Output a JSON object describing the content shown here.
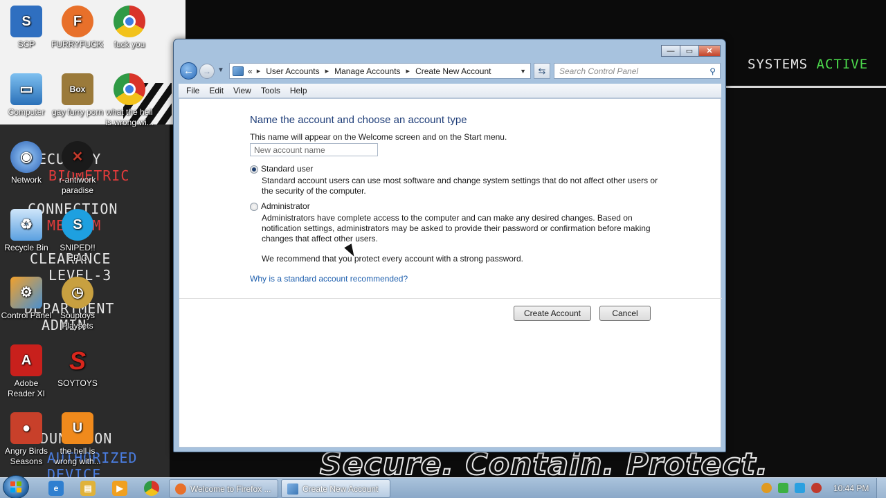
{
  "wallpaper": {
    "systems_label": "SYSTEMS",
    "systems_status": "ACTIVE",
    "overlay_lines": [
      "ECURITY",
      "BIOMETRIC",
      "CONNECTION",
      "MEDIUM",
      "CLEARANCE",
      "LEVEL-3",
      "DEPARTMENT",
      "ADMIN",
      "DUNCTION",
      "AUTHORIZED",
      "DEVICE"
    ],
    "motto": "Secure. Contain. Protect."
  },
  "desktop_icons": [
    {
      "label": "SCP",
      "icon": "scp-icon",
      "color": "#2f6fc0"
    },
    {
      "label": "FURRYFUCKS",
      "icon": "firefox-icon",
      "color": "#e8702a"
    },
    {
      "label": "fuck you",
      "icon": "chrome-icon",
      "color": "#2f9a45"
    },
    {
      "label": "Computer",
      "icon": "computer-icon",
      "color": "#3a86d0"
    },
    {
      "label": "gay furry porn",
      "icon": "box-icon",
      "color": "#9b7a3a"
    },
    {
      "label": "what the hell is wrong wi...",
      "icon": "chrome-icon",
      "color": "#2f9a45"
    },
    {
      "label": "Network",
      "icon": "network-icon",
      "color": "#3f7fd0"
    },
    {
      "label": "r-antiwork paradise",
      "icon": "antiwork-icon",
      "color": "#1a1a1a"
    },
    {
      "label": "Recycle Bin",
      "icon": "recycle-bin-icon",
      "color": "#5aa0e0"
    },
    {
      "label": "SNIPED!! EPIC GAMM...",
      "icon": "skype-icon",
      "color": "#1ea0e0"
    },
    {
      "label": "Control Panel",
      "icon": "control-panel-icon",
      "color": "#4a90d0"
    },
    {
      "label": "Souptoys Playsets",
      "icon": "souptoys-icon",
      "color": "#c8a040"
    },
    {
      "label": "Adobe Reader XI",
      "icon": "adobe-reader-icon",
      "color": "#c8201c"
    },
    {
      "label": "SOYTOYS",
      "icon": "soytoys-icon",
      "color": "#d8261c"
    },
    {
      "label": "Angry Birds Seasons",
      "icon": "angry-birds-icon",
      "color": "#c8402a"
    },
    {
      "label": "the hell is wrong with...",
      "icon": "uc-browser-icon",
      "color": "#f08a1c"
    }
  ],
  "window": {
    "address": {
      "overflow": "«",
      "crumbs": [
        "User Accounts",
        "Manage Accounts",
        "Create New Account"
      ]
    },
    "search_placeholder": "Search Control Panel",
    "menu": [
      "File",
      "Edit",
      "View",
      "Tools",
      "Help"
    ],
    "heading": "Name the account and choose an account type",
    "subtext": "This name will appear on the Welcome screen and on the Start menu.",
    "name_placeholder": "New account name",
    "options": [
      {
        "label": "Standard user",
        "checked": true,
        "description": "Standard account users can use most software and change system settings that do not affect other users or the security of the computer."
      },
      {
        "label": "Administrator",
        "checked": false,
        "description": "Administrators have complete access to the computer and can make any desired changes. Based on notification settings, administrators may be asked to provide their password or confirmation before making changes that affect other users."
      }
    ],
    "recommendation": "We recommend that you protect every account with a strong password.",
    "help_link": "Why is a standard account recommended?",
    "create_button": "Create Account",
    "cancel_button": "Cancel"
  },
  "taskbar": {
    "tasks": [
      {
        "label": "Welcome to Firefox ...",
        "icon": "firefox-icon",
        "active": false
      },
      {
        "label": "Create New Account",
        "icon": "control-panel-icon",
        "active": true
      }
    ],
    "clock": "10:44 PM"
  }
}
